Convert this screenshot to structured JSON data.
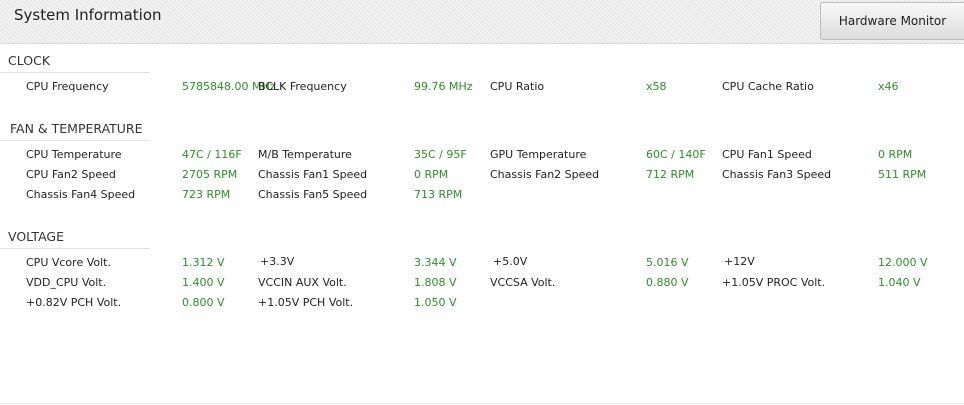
{
  "header": {
    "title": "System Information",
    "button_label": "Hardware Monitor"
  },
  "sections": {
    "clock": {
      "title": "CLOCK",
      "items": [
        {
          "label": "CPU Frequency",
          "value": "5785848.00 MHz"
        },
        {
          "label": "BCLK Frequency",
          "value": "99.76 MHz"
        },
        {
          "label": "CPU Ratio",
          "value": "x58"
        },
        {
          "label": "CPU Cache Ratio",
          "value": "x46"
        }
      ]
    },
    "fan_temp": {
      "title": "FAN & TEMPERATURE",
      "items": [
        {
          "label": "CPU Temperature",
          "value": "47C / 116F"
        },
        {
          "label": "M/B Temperature",
          "value": "35C / 95F"
        },
        {
          "label": "GPU Temperature",
          "value": "60C / 140F"
        },
        {
          "label": "CPU Fan1 Speed",
          "value": "0 RPM"
        },
        {
          "label": "CPU Fan2 Speed",
          "value": "2705 RPM"
        },
        {
          "label": "Chassis Fan1 Speed",
          "value": "0 RPM"
        },
        {
          "label": "Chassis Fan2 Speed",
          "value": "712 RPM"
        },
        {
          "label": "Chassis Fan3 Speed",
          "value": "511 RPM"
        },
        {
          "label": "Chassis Fan4 Speed",
          "value": "723 RPM"
        },
        {
          "label": "Chassis Fan5 Speed",
          "value": "713 RPM"
        }
      ]
    },
    "voltage": {
      "title": "VOLTAGE",
      "items": [
        {
          "label": "CPU Vcore Volt.",
          "value": "1.312 V"
        },
        {
          "label": "+3.3V",
          "value": "3.344 V"
        },
        {
          "label": "+5.0V",
          "value": "5.016 V"
        },
        {
          "label": "+12V",
          "value": "12.000 V"
        },
        {
          "label": "VDD_CPU Volt.",
          "value": "1.400 V"
        },
        {
          "label": "VCCIN AUX Volt.",
          "value": "1.808 V"
        },
        {
          "label": "VCCSA Volt.",
          "value": "0.880 V"
        },
        {
          "label": "+1.05V PROC Volt.",
          "value": "1.040 V"
        },
        {
          "label": "+0.82V PCH Volt.",
          "value": "0.800 V"
        },
        {
          "label": "+1.05V PCH Volt.",
          "value": "1.050 V"
        }
      ]
    }
  },
  "colors": {
    "value_green": "#2e8b2e",
    "text": "#222222"
  }
}
